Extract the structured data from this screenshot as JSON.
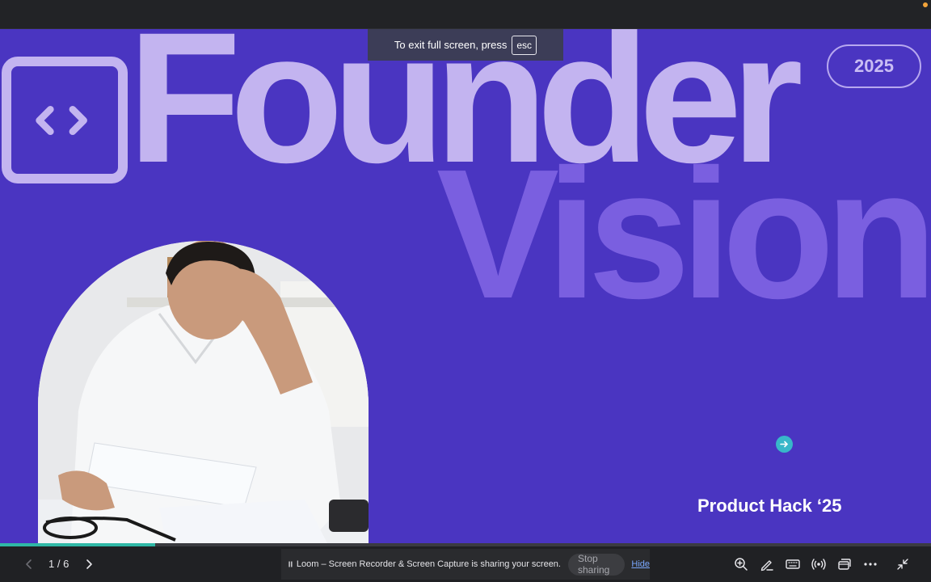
{
  "slide": {
    "title_line1": "Founder",
    "title_line2": "Vision",
    "year_badge": "2025",
    "subtitle": "Product Hack ‘25",
    "logo_icon": "code-brackets-icon",
    "photo_icon": "stressed-founder-photo",
    "background_color": "#4a35c1",
    "accent_light": "#c3b4f0",
    "accent_mid": "#7a5fe0"
  },
  "fullscreen_banner": {
    "text": "To exit full screen, press",
    "key": "esc"
  },
  "presentation": {
    "page_counter": "1 / 6",
    "progress": 0.167,
    "prev_icon": "chevron-left-icon",
    "next_icon": "chevron-right-icon"
  },
  "screen_share": {
    "message": "Loom – Screen Recorder & Screen Capture is sharing your screen.",
    "stop_label": "Stop sharing",
    "hide_label": "Hide"
  },
  "toolbar": {
    "icons": [
      "zoom-in-icon",
      "pen-icon",
      "keyboard-icon",
      "broadcast-icon",
      "windows-icon",
      "more-icon",
      "exit-fullscreen-icon"
    ]
  }
}
